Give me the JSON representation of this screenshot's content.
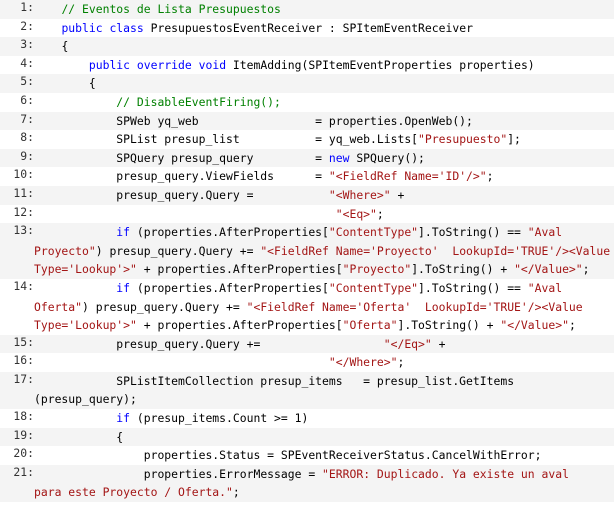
{
  "code_lines": [
    {
      "num": "1:",
      "lines": [
        [
          {
            "t": "    ",
            "c": "pl"
          },
          {
            "t": "// Eventos de Lista Presupuestos",
            "c": "cm"
          }
        ]
      ]
    },
    {
      "num": "2:",
      "lines": [
        [
          {
            "t": "    ",
            "c": "pl"
          },
          {
            "t": "public",
            "c": "kw"
          },
          {
            "t": " ",
            "c": "pl"
          },
          {
            "t": "class",
            "c": "kw"
          },
          {
            "t": " PresupuestosEventReceiver : SPItemEventReceiver",
            "c": "pl"
          }
        ]
      ]
    },
    {
      "num": "3:",
      "lines": [
        [
          {
            "t": "    {",
            "c": "pl"
          }
        ]
      ]
    },
    {
      "num": "4:",
      "lines": [
        [
          {
            "t": "        ",
            "c": "pl"
          },
          {
            "t": "public",
            "c": "kw"
          },
          {
            "t": " ",
            "c": "pl"
          },
          {
            "t": "override",
            "c": "kw"
          },
          {
            "t": " ",
            "c": "pl"
          },
          {
            "t": "void",
            "c": "kw"
          },
          {
            "t": " ItemAdding(SPItemEventProperties properties)",
            "c": "pl"
          }
        ]
      ]
    },
    {
      "num": "5:",
      "lines": [
        [
          {
            "t": "        {",
            "c": "pl"
          }
        ]
      ]
    },
    {
      "num": "6:",
      "lines": [
        [
          {
            "t": "            ",
            "c": "pl"
          },
          {
            "t": "// DisableEventFiring();",
            "c": "cm"
          }
        ]
      ]
    },
    {
      "num": "7:",
      "lines": [
        [
          {
            "t": "            SPWeb yq_web                 = properties.OpenWeb();",
            "c": "pl"
          }
        ]
      ]
    },
    {
      "num": "8:",
      "lines": [
        [
          {
            "t": "            SPList presup_list           = yq_web.Lists[",
            "c": "pl"
          },
          {
            "t": "\"Presupuesto\"",
            "c": "st"
          },
          {
            "t": "];",
            "c": "pl"
          }
        ]
      ]
    },
    {
      "num": "9:",
      "lines": [
        [
          {
            "t": "            SPQuery presup_query         = ",
            "c": "pl"
          },
          {
            "t": "new",
            "c": "kw"
          },
          {
            "t": " SPQuery();",
            "c": "pl"
          }
        ]
      ]
    },
    {
      "num": "10:",
      "lines": [
        [
          {
            "t": "            presup_query.ViewFields      = ",
            "c": "pl"
          },
          {
            "t": "\"<FieldRef Name='ID'/>\"",
            "c": "st"
          },
          {
            "t": ";",
            "c": "pl"
          }
        ]
      ]
    },
    {
      "num": "11:",
      "lines": [
        [
          {
            "t": "            presup_query.Query =           ",
            "c": "pl"
          },
          {
            "t": "\"<Where>\"",
            "c": "st"
          },
          {
            "t": " +",
            "c": "pl"
          }
        ]
      ]
    },
    {
      "num": "12:",
      "lines": [
        [
          {
            "t": "                                            ",
            "c": "pl"
          },
          {
            "t": "\"<Eq>\"",
            "c": "st"
          },
          {
            "t": ";",
            "c": "pl"
          }
        ]
      ]
    },
    {
      "num": "13:",
      "lines": [
        [
          {
            "t": "            ",
            "c": "pl"
          },
          {
            "t": "if",
            "c": "kw"
          },
          {
            "t": " (properties.AfterProperties[",
            "c": "pl"
          },
          {
            "t": "\"ContentType\"",
            "c": "st"
          },
          {
            "t": "].ToString() == ",
            "c": "pl"
          },
          {
            "t": "\"Aval",
            "c": "st"
          }
        ],
        [
          {
            "t": "Proyecto\"",
            "c": "st"
          },
          {
            "t": ") presup_query.Query += ",
            "c": "pl"
          },
          {
            "t": "\"<FieldRef Name='Proyecto'  LookupId='TRUE'/><Value",
            "c": "st"
          }
        ],
        [
          {
            "t": "Type='Lookup'>\"",
            "c": "st"
          },
          {
            "t": " + properties.AfterProperties[",
            "c": "pl"
          },
          {
            "t": "\"Proyecto\"",
            "c": "st"
          },
          {
            "t": "].ToString() + ",
            "c": "pl"
          },
          {
            "t": "\"</Value>\"",
            "c": "st"
          },
          {
            "t": ";",
            "c": "pl"
          }
        ]
      ]
    },
    {
      "num": "14:",
      "lines": [
        [
          {
            "t": "            ",
            "c": "pl"
          },
          {
            "t": "if",
            "c": "kw"
          },
          {
            "t": " (properties.AfterProperties[",
            "c": "pl"
          },
          {
            "t": "\"ContentType\"",
            "c": "st"
          },
          {
            "t": "].ToString() == ",
            "c": "pl"
          },
          {
            "t": "\"Aval",
            "c": "st"
          }
        ],
        [
          {
            "t": "Oferta\"",
            "c": "st"
          },
          {
            "t": ") presup_query.Query += ",
            "c": "pl"
          },
          {
            "t": "\"<FieldRef Name='Oferta'  LookupId='TRUE'/><Value",
            "c": "st"
          }
        ],
        [
          {
            "t": "Type='Lookup'>\"",
            "c": "st"
          },
          {
            "t": " + properties.AfterProperties[",
            "c": "pl"
          },
          {
            "t": "\"Oferta\"",
            "c": "st"
          },
          {
            "t": "].ToString() + ",
            "c": "pl"
          },
          {
            "t": "\"</Value>\"",
            "c": "st"
          },
          {
            "t": ";",
            "c": "pl"
          }
        ]
      ]
    },
    {
      "num": "15:",
      "lines": [
        [
          {
            "t": "            presup_query.Query +=                  ",
            "c": "pl"
          },
          {
            "t": "\"</Eq>\"",
            "c": "st"
          },
          {
            "t": " +",
            "c": "pl"
          }
        ]
      ]
    },
    {
      "num": "16:",
      "lines": [
        [
          {
            "t": "                                           ",
            "c": "pl"
          },
          {
            "t": "\"</Where>\"",
            "c": "st"
          },
          {
            "t": ";",
            "c": "pl"
          }
        ]
      ]
    },
    {
      "num": "17:",
      "lines": [
        [
          {
            "t": "            SPListItemCollection presup_items   = presup_list.GetItems",
            "c": "pl"
          }
        ],
        [
          {
            "t": "(presup_query);",
            "c": "pl"
          }
        ]
      ]
    },
    {
      "num": "18:",
      "lines": [
        [
          {
            "t": "            ",
            "c": "pl"
          },
          {
            "t": "if",
            "c": "kw"
          },
          {
            "t": " (presup_items.Count >= 1)",
            "c": "pl"
          }
        ]
      ]
    },
    {
      "num": "19:",
      "lines": [
        [
          {
            "t": "            {",
            "c": "pl"
          }
        ]
      ]
    },
    {
      "num": "20:",
      "lines": [
        [
          {
            "t": "                properties.Status = SPEventReceiverStatus.CancelWithError;",
            "c": "pl"
          }
        ]
      ]
    },
    {
      "num": "21:",
      "lines": [
        [
          {
            "t": "                properties.ErrorMessage = ",
            "c": "pl"
          },
          {
            "t": "\"ERROR: Duplicado. Ya existe un aval",
            "c": "st"
          }
        ],
        [
          {
            "t": "para este Proyecto / Oferta.\"",
            "c": "st"
          },
          {
            "t": ";",
            "c": "pl"
          }
        ]
      ]
    }
  ],
  "colors": {
    "keyword": "#0000ff",
    "comment": "#008000",
    "string": "#a31515",
    "line_number": "#333333",
    "alt_row": "#f4f4f4"
  }
}
